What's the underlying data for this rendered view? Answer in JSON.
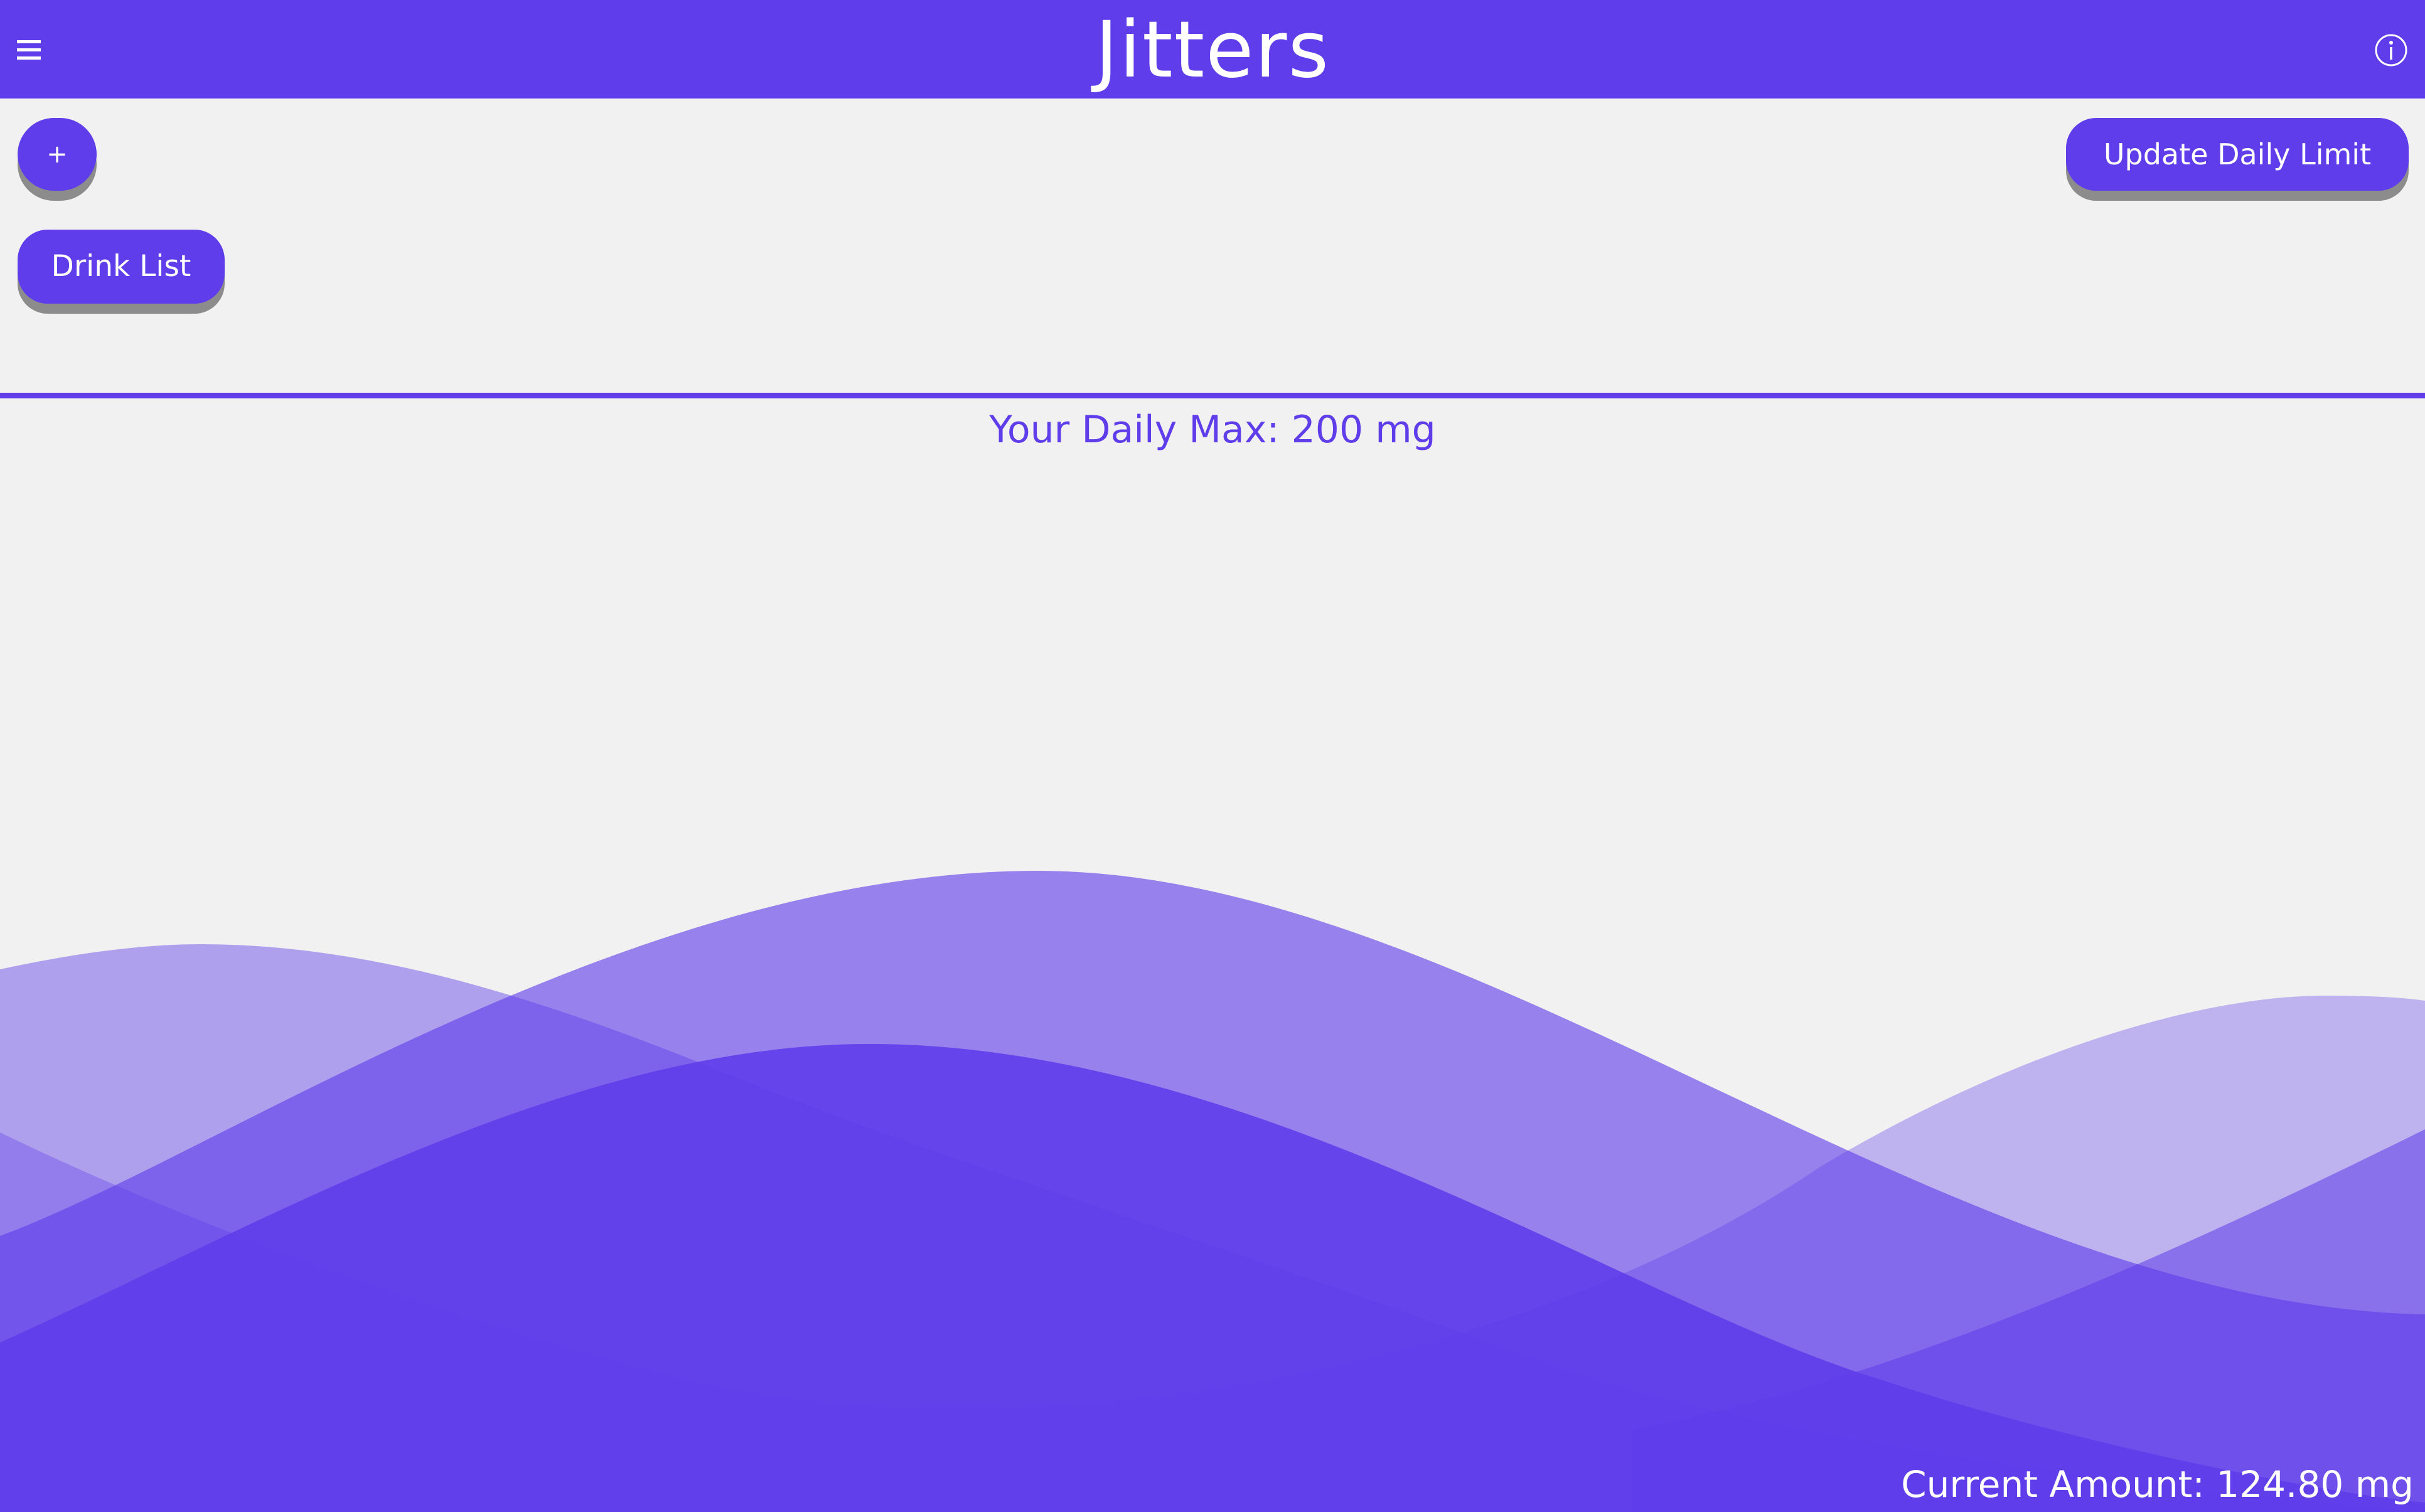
{
  "header": {
    "title": "Jitters",
    "menu_icon": "hamburger-menu-icon",
    "info_icon": "info-icon"
  },
  "actions": {
    "add_label": "+",
    "update_limit_label": "Update Daily Limit",
    "drink_list_label": "Drink List"
  },
  "status": {
    "daily_max_text": "Your Daily Max: 200 mg",
    "current_amount_text": "Current Amount: 124.80 mg"
  },
  "colors": {
    "accent": "#5f3dea",
    "background": "#f1f1f1",
    "button_shadow": "#8c8c8c",
    "text_light": "#ffffff"
  }
}
